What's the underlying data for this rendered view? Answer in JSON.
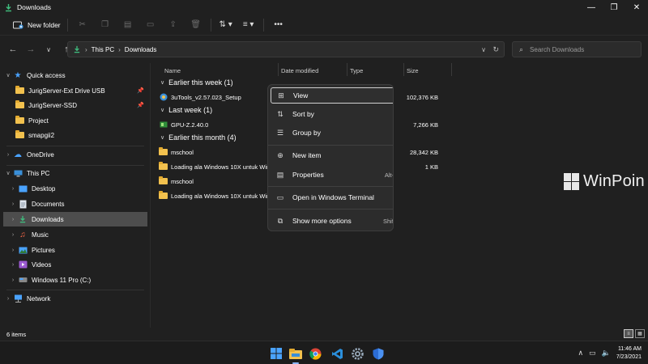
{
  "window": {
    "title": "Downloads",
    "controls": {
      "minimize": "—",
      "maximize": "❐",
      "close": "✕"
    }
  },
  "toolbar": {
    "new_folder_label": "New folder",
    "icons": [
      "cut-icon",
      "copy-icon",
      "paste-icon",
      "rename-icon",
      "share-icon",
      "delete-icon",
      "sort-icon",
      "view-icon",
      "more-icon"
    ]
  },
  "address": {
    "crumbs": [
      "This PC",
      "Downloads"
    ],
    "search_placeholder": "Search Downloads"
  },
  "sidebar": {
    "items": [
      {
        "label": "Quick access"
      },
      {
        "label": "JurigServer-Ext Drive USB"
      },
      {
        "label": "JurigServer-SSD"
      },
      {
        "label": "Project"
      },
      {
        "label": "smapgii2"
      },
      {
        "label": "OneDrive"
      },
      {
        "label": "This PC"
      },
      {
        "label": "Desktop"
      },
      {
        "label": "Documents"
      },
      {
        "label": "Downloads"
      },
      {
        "label": "Music"
      },
      {
        "label": "Pictures"
      },
      {
        "label": "Videos"
      },
      {
        "label": "Windows 11 Pro (C:)"
      },
      {
        "label": "Network"
      }
    ]
  },
  "columns": {
    "name": "Name",
    "date": "Date modified",
    "type": "Type",
    "size": "Size"
  },
  "groups": [
    {
      "label": "Earlier this week (1)"
    },
    {
      "label": "Last week (1)"
    },
    {
      "label": "Earlier this month (4)"
    }
  ],
  "files": [
    {
      "name": "3uTools_v2.57.023_Setup",
      "size": "102,376 KB"
    },
    {
      "name": "GPU-Z.2.40.0",
      "size": "7,266 KB"
    },
    {
      "name": "mschool",
      "size": "28,342 KB"
    },
    {
      "name": "Loading ala Windows 10X untuk Windo",
      "size": "1 KB"
    },
    {
      "name": "mschool",
      "size": ""
    },
    {
      "name": "Loading ala Windows 10X untuk Windo",
      "size": ""
    }
  ],
  "context_menu": {
    "items": [
      {
        "label": "View",
        "shortcut": ""
      },
      {
        "label": "Sort by",
        "shortcut": ""
      },
      {
        "label": "Group by",
        "shortcut": ""
      },
      {
        "label": "New item",
        "shortcut": ""
      },
      {
        "label": "Properties",
        "shortcut": "Alt+"
      },
      {
        "label": "Open in Windows Terminal",
        "shortcut": ""
      },
      {
        "label": "Show more options",
        "shortcut": "Shift"
      }
    ]
  },
  "watermark": "WinPoin",
  "status": {
    "item_count": "6 items"
  },
  "taskbar": {
    "apps": [
      "windows-start",
      "file-explorer",
      "chrome",
      "vscode",
      "settings",
      "windows-security"
    ],
    "time": "11:46 AM",
    "date": "7/23/2021"
  },
  "colors": {
    "background": "#202020",
    "sidebar_active": "#4d4d4d",
    "menu_bg": "#2c2c2c",
    "folder": "#f2c14e",
    "download_arrow": "#3fbf7f"
  }
}
